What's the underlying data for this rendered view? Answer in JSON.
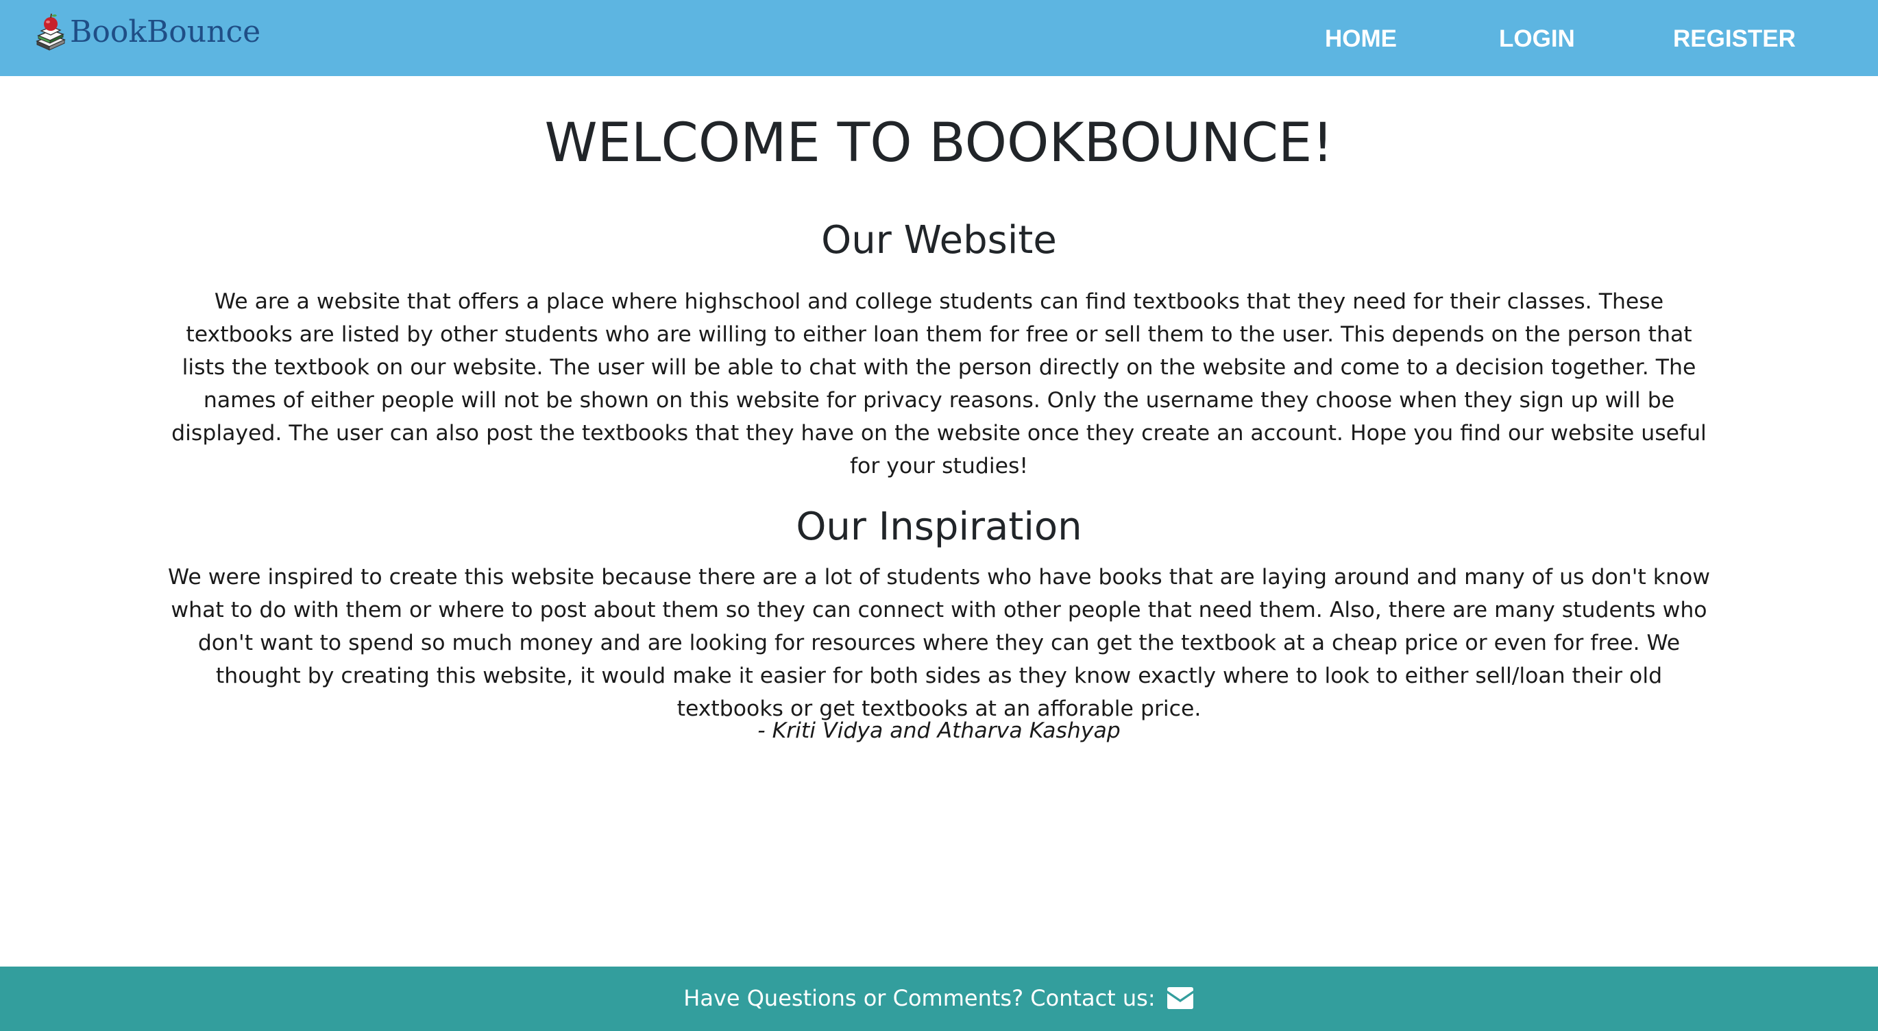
{
  "navbar": {
    "brand": "BookBounce",
    "brand_icon": "book-stack-apple-icon",
    "links": {
      "home": "HOME",
      "login": "LOGIN",
      "register": "REGISTER"
    }
  },
  "main": {
    "title": "WELCOME TO BOOKBOUNCE!",
    "website": {
      "heading": "Our Website",
      "body": "We are a website that offers a place where highschool and college students can find textbooks that they need for their classes. These textbooks are listed by other students who are willing to either loan them for free or sell them to the user. This depends on the person that lists the textbook on our website. The user will be able to chat with the person directly on the website and come to a decision together. The names of either people will not be shown on this website for privacy reasons. Only the username they choose when they sign up will be displayed. The user can also post the textbooks that they have on the website once they create an account. Hope you find our website useful for your studies!"
    },
    "inspiration": {
      "heading": "Our Inspiration",
      "body": "We were inspired to create this website because there are a lot of students who have books that are laying around and many of us don't know what to do with them or where to post about them so they can connect with other people that need them. Also, there are many students who don't want to spend so much money and are looking for resources where they can get the textbook at a cheap price or even for free. We thought by creating this website, it would make it easier for both sides as they know exactly where to look to either sell/loan their old textbooks or get textbooks at an afforable price.",
      "signature": "- Kriti Vidya and Atharva Kashyap"
    }
  },
  "footer": {
    "text": "Have Questions or Comments? Contact us:",
    "icon": "envelope-icon"
  },
  "colors": {
    "navbar": "#5db5e1",
    "footer": "#339e9d",
    "brand_text": "#1f4e86"
  }
}
